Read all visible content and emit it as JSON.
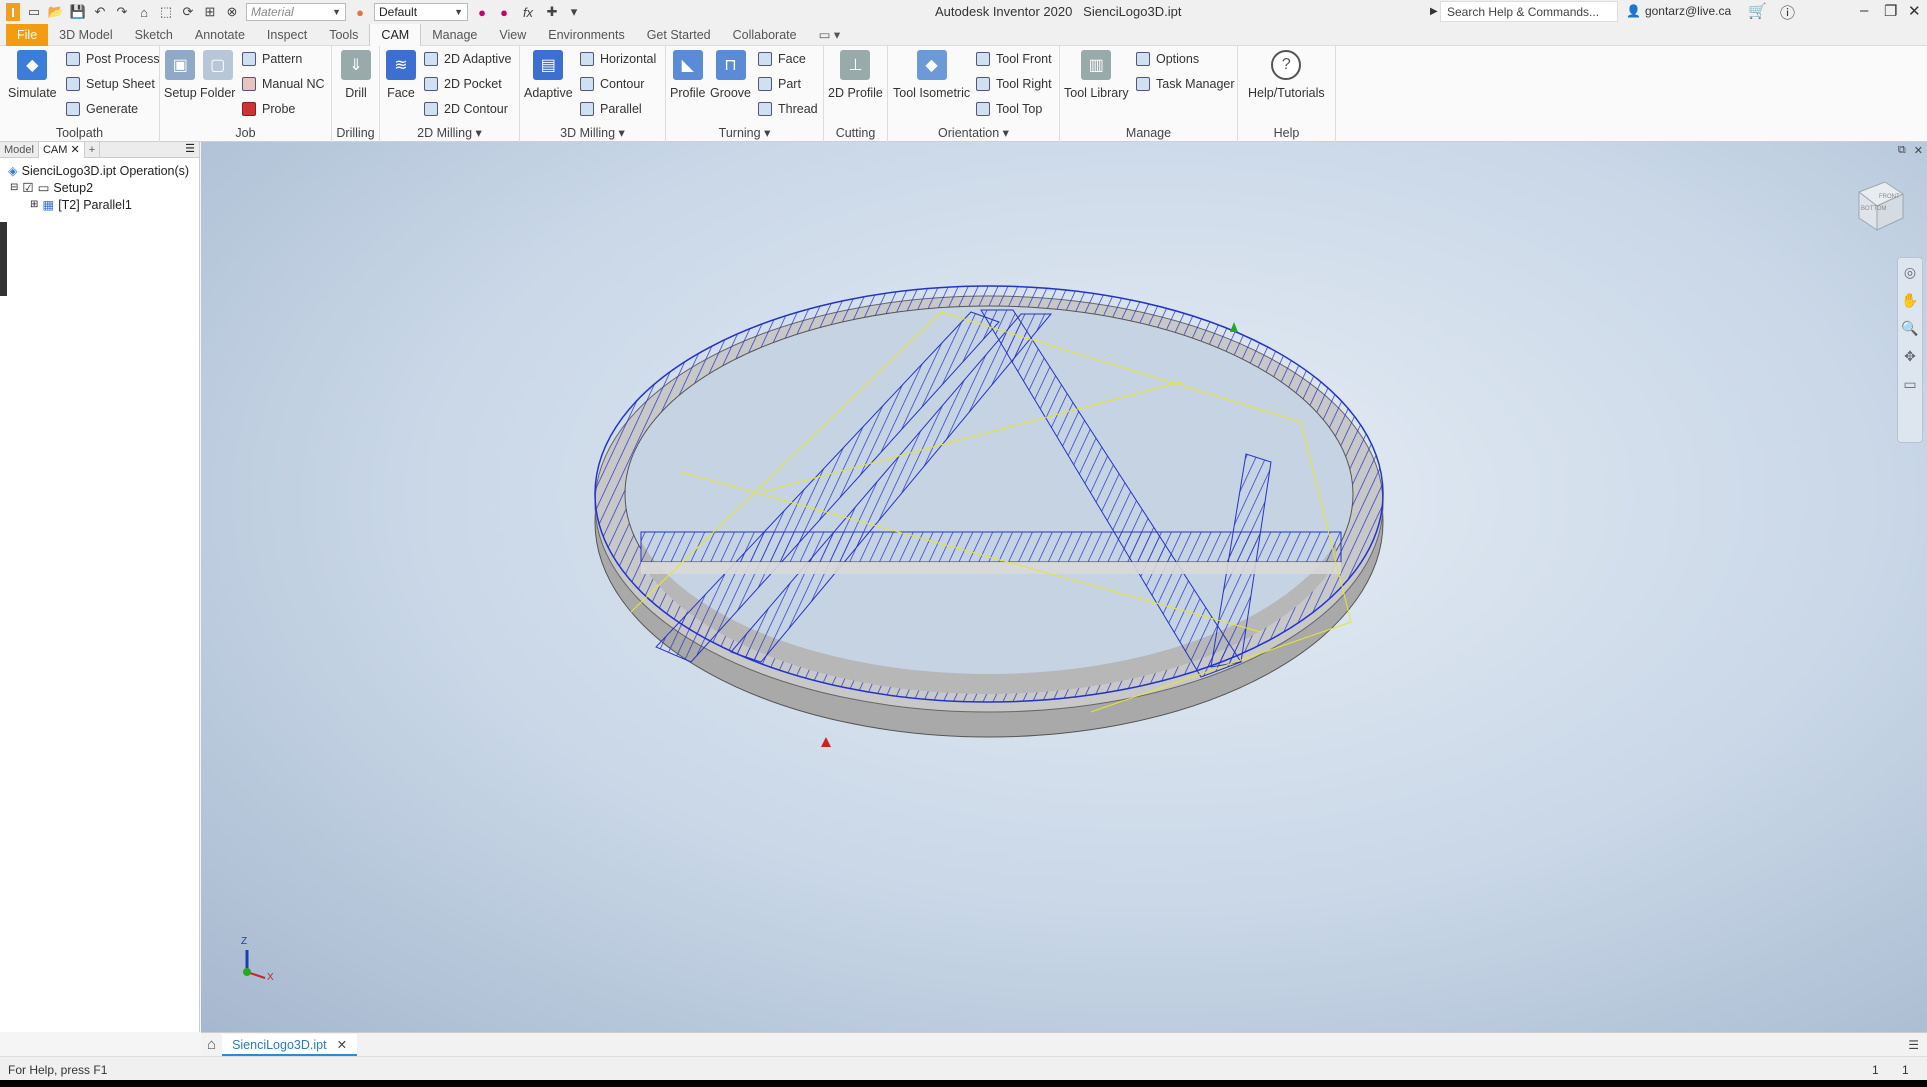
{
  "titlebar": {
    "material_placeholder": "Material",
    "appearance_value": "Default",
    "fx_label": "fx",
    "app_title": "Autodesk Inventor 2020",
    "file_title": "SienciLogo3D.ipt",
    "search_placeholder": "Search Help & Commands...",
    "user": "gontarz@live.ca"
  },
  "menu": {
    "tabs": [
      "File",
      "3D Model",
      "Sketch",
      "Annotate",
      "Inspect",
      "Tools",
      "CAM",
      "Manage",
      "View",
      "Environments",
      "Get Started",
      "Collaborate"
    ],
    "active": "CAM"
  },
  "ribbon": {
    "toolpath": {
      "title": "Toolpath",
      "simulate": "Simulate",
      "post_process": "Post Process",
      "setup_sheet": "Setup Sheet",
      "generate": "Generate"
    },
    "job": {
      "title": "Job",
      "setup": "Setup",
      "folder": "Folder",
      "pattern": "Pattern",
      "manual_nc": "Manual NC",
      "probe": "Probe"
    },
    "drilling": {
      "title": "Drilling",
      "drill": "Drill"
    },
    "milling2d": {
      "title": "2D Milling",
      "face": "Face",
      "adaptive": "2D Adaptive",
      "pocket": "2D Pocket",
      "contour": "2D Contour"
    },
    "milling3d": {
      "title": "3D Milling",
      "adaptive": "Adaptive",
      "horizontal": "Horizontal",
      "contour": "Contour",
      "parallel": "Parallel"
    },
    "turning": {
      "title": "Turning",
      "profile": "Profile",
      "groove": "Groove",
      "face": "Face",
      "part": "Part",
      "thread": "Thread"
    },
    "cutting": {
      "title": "Cutting",
      "profile2d": "2D Profile"
    },
    "orientation": {
      "title": "Orientation",
      "tool_isometric": "Tool Isometric",
      "tool_front": "Tool Front",
      "tool_right": "Tool Right",
      "tool_top": "Tool Top"
    },
    "manage": {
      "title": "Manage",
      "tool_library": "Tool Library",
      "options": "Options",
      "task_manager": "Task Manager"
    },
    "help": {
      "title": "Help",
      "help_tutorials": "Help/Tutorials"
    }
  },
  "browser": {
    "tab_model": "Model",
    "tab_cam": "CAM",
    "root": "SienciLogo3D.ipt Operation(s)",
    "setup": "Setup2",
    "operation": "[T2] Parallel1"
  },
  "viewcube": {
    "front": "FRONT",
    "bottom": "BOTTOM"
  },
  "triad": {
    "z": "Z",
    "x": "X"
  },
  "doc_tab": "SienciLogo3D.ipt",
  "status": {
    "help": "For Help, press F1",
    "count1": "1",
    "count2": "1"
  },
  "colors": {
    "file_tab": "#f39c12",
    "toolpath": "#2233cc",
    "model": "#c8c8c8"
  }
}
